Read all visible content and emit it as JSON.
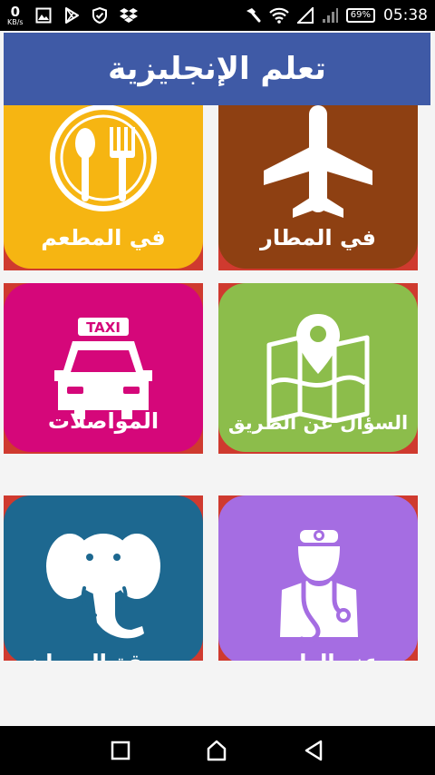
{
  "status_bar": {
    "speed_value": "0",
    "speed_unit": "KB/s",
    "battery": "69%",
    "time": "05:38",
    "left_icons": [
      "image-icon",
      "play-store-icon",
      "shield-icon",
      "dropbox-icon"
    ],
    "right_icons": [
      "hammer-icon",
      "wifi-icon",
      "signal-icon",
      "signal-empty-icon"
    ]
  },
  "app_bar": {
    "title": "تعلم الإنجليزية",
    "color": "#3f5aa6"
  },
  "categories": [
    {
      "label": "في المطار",
      "color": "#8e4012",
      "icon": "airplane-icon"
    },
    {
      "label": "في المطعم",
      "color": "#f6b512",
      "icon": "restaurant-icon"
    },
    {
      "label": "السؤال عن الطريق",
      "color": "#8cbd4b",
      "icon": "map-pin-icon"
    },
    {
      "label": "المواصلات",
      "color": "#d5077a",
      "icon": "taxi-icon",
      "badge": "TAXI"
    },
    {
      "label": "عند الطبيب",
      "color": "#a56de2",
      "icon": "doctor-icon"
    },
    {
      "label": "حديقة الحيوان",
      "color": "#1d6890",
      "icon": "elephant-icon"
    }
  ],
  "tile_border_color": "#cf3a2f",
  "nav_bar": {
    "icons": [
      "recent-apps-icon",
      "home-icon",
      "back-icon"
    ]
  }
}
